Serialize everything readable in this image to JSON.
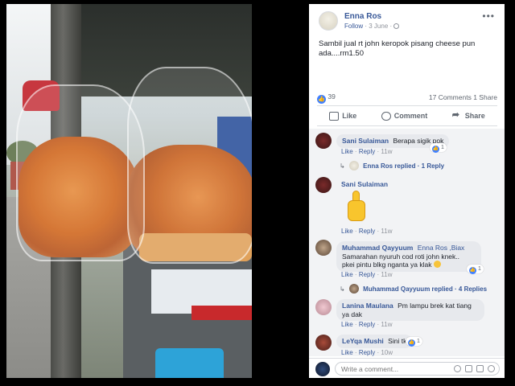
{
  "post": {
    "author": "Enna Ros",
    "follow_label": "Follow",
    "date": "3 June",
    "text": "Sambil jual rt john keropok pisang cheese pun ada....rm1.50",
    "like_count": "39",
    "comments_count": "17 Comments",
    "shares_count": "1 Share",
    "actions": {
      "like": "Like",
      "comment": "Comment",
      "share": "Share"
    }
  },
  "comments": [
    {
      "name": "Sani Sulaiman",
      "text": "Berapa sigik pok",
      "like": "Like",
      "reply": "Reply",
      "time": "11w",
      "reactions": "1",
      "replies": {
        "author": "Enna Ros replied",
        "count": "1 Reply"
      }
    },
    {
      "name": "Sani Sulaiman",
      "text": "",
      "sticker": "thumbs-up-sticker",
      "like": "Like",
      "reply": "Reply",
      "time": "11w"
    },
    {
      "name": "Muhammad Qayyuum",
      "text_line1": "Enna Ros ,Biax",
      "text_line2": "Samarahan nyuruh cod roti john knek..",
      "text_line3": "pkei pintu blkg nganta ya klak",
      "like": "Like",
      "reply": "Reply",
      "time": "11w",
      "reactions": "1",
      "replies": {
        "author": "Muhammad Qayyuum replied",
        "count": "4 Replies"
      }
    },
    {
      "name": "Lanina Maulana",
      "text_line1": "Pm lampu brek kat tiang",
      "text_line2": "ya dak",
      "like": "Like",
      "reply": "Reply",
      "time": "11w"
    },
    {
      "name": "LeYqa Mushi",
      "text": "Sini tk",
      "like": "Like",
      "reply": "Reply",
      "time": "10w",
      "reactions": "1"
    }
  ],
  "compose": {
    "placeholder": "Write a comment..."
  },
  "colors": {
    "link": "#385898",
    "like_blue": "#4080ff",
    "meta_gray": "#90949c",
    "bubble": "#e7e9ed"
  }
}
